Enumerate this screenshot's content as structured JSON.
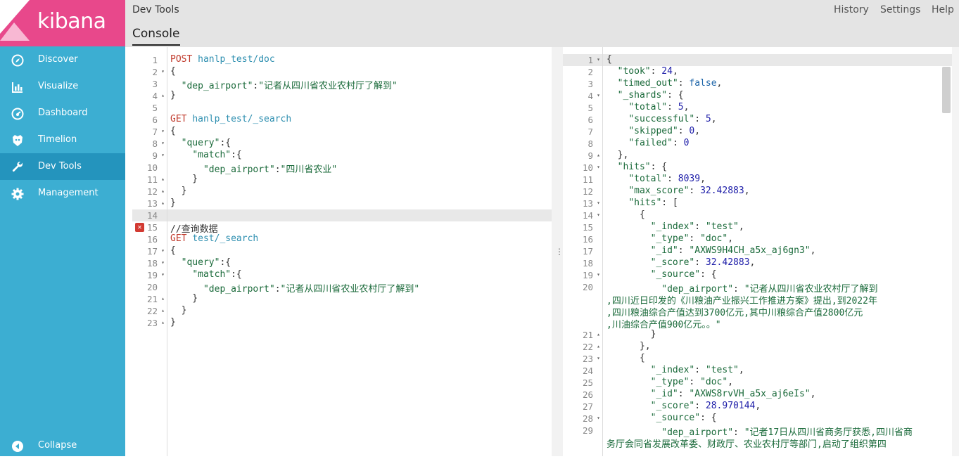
{
  "app": {
    "logo_text": "kibana"
  },
  "nav": [
    {
      "label": "Discover",
      "icon": "compass-icon"
    },
    {
      "label": "Visualize",
      "icon": "bar-chart-icon"
    },
    {
      "label": "Dashboard",
      "icon": "dashboard-icon"
    },
    {
      "label": "Timelion",
      "icon": "timelion-icon"
    },
    {
      "label": "Dev Tools",
      "icon": "wrench-icon",
      "active": true
    },
    {
      "label": "Management",
      "icon": "gear-icon"
    }
  ],
  "collapse_label": "Collapse",
  "header": {
    "breadcrumb": "Dev Tools",
    "links": [
      "History",
      "Settings",
      "Help"
    ],
    "tab": "Console"
  },
  "left_lines": [
    {
      "n": "1",
      "t": [
        [
          "k-m",
          "POST"
        ],
        [
          "k-p",
          " "
        ],
        [
          "k-u",
          "hanlp_test/doc"
        ]
      ]
    },
    {
      "n": "2",
      "f": "▾",
      "t": [
        [
          "k-p",
          "{"
        ]
      ]
    },
    {
      "n": "3",
      "t": [
        [
          "k-p",
          "  "
        ],
        [
          "k-s",
          "\"dep_airport\""
        ],
        [
          "k-p",
          ":"
        ],
        [
          "k-s",
          "\"记者从四川省农业农村厅了解到\""
        ]
      ]
    },
    {
      "n": "4",
      "f": "▴",
      "t": [
        [
          "k-p",
          "}"
        ]
      ]
    },
    {
      "n": "5",
      "t": []
    },
    {
      "n": "6",
      "t": [
        [
          "k-m",
          "GET"
        ],
        [
          "k-p",
          " "
        ],
        [
          "k-u",
          "hanlp_test/_search"
        ]
      ]
    },
    {
      "n": "7",
      "f": "▾",
      "t": [
        [
          "k-p",
          "{"
        ]
      ]
    },
    {
      "n": "8",
      "f": "▾",
      "t": [
        [
          "k-p",
          "  "
        ],
        [
          "k-s",
          "\"query\""
        ],
        [
          "k-p",
          ":{"
        ]
      ]
    },
    {
      "n": "9",
      "f": "▾",
      "t": [
        [
          "k-p",
          "    "
        ],
        [
          "k-s",
          "\"match\""
        ],
        [
          "k-p",
          ":{"
        ]
      ]
    },
    {
      "n": "10",
      "t": [
        [
          "k-p",
          "      "
        ],
        [
          "k-s",
          "\"dep_airport\""
        ],
        [
          "k-p",
          ":"
        ],
        [
          "k-s",
          "\"四川省农业\""
        ]
      ]
    },
    {
      "n": "11",
      "f": "▴",
      "t": [
        [
          "k-p",
          "    }"
        ]
      ]
    },
    {
      "n": "12",
      "f": "▴",
      "t": [
        [
          "k-p",
          "  }"
        ]
      ]
    },
    {
      "n": "13",
      "f": "▴",
      "t": [
        [
          "k-p",
          "}"
        ]
      ]
    },
    {
      "n": "14",
      "t": []
    },
    {
      "n": "15",
      "err": true,
      "t": [
        [
          "k-p",
          "//查询数据"
        ]
      ]
    },
    {
      "n": "16",
      "t": [
        [
          "k-m",
          "GET"
        ],
        [
          "k-p",
          " "
        ],
        [
          "k-u",
          "test/_search"
        ]
      ]
    },
    {
      "n": "17",
      "f": "▾",
      "t": [
        [
          "k-p",
          "{"
        ]
      ]
    },
    {
      "n": "18",
      "f": "▾",
      "t": [
        [
          "k-p",
          "  "
        ],
        [
          "k-s",
          "\"query\""
        ],
        [
          "k-p",
          ":{"
        ]
      ]
    },
    {
      "n": "19",
      "f": "▾",
      "t": [
        [
          "k-p",
          "    "
        ],
        [
          "k-s",
          "\"match\""
        ],
        [
          "k-p",
          ":{"
        ]
      ]
    },
    {
      "n": "20",
      "t": [
        [
          "k-p",
          "      "
        ],
        [
          "k-s",
          "\"dep_airport\""
        ],
        [
          "k-p",
          ":"
        ],
        [
          "k-s",
          "\"记者从四川省农业农村厅了解到\""
        ]
      ]
    },
    {
      "n": "21",
      "f": "▴",
      "t": [
        [
          "k-p",
          "    }"
        ]
      ]
    },
    {
      "n": "22",
      "f": "▴",
      "t": [
        [
          "k-p",
          "  }"
        ]
      ]
    },
    {
      "n": "23",
      "f": "▴",
      "t": [
        [
          "k-p",
          "}"
        ]
      ]
    }
  ],
  "right_lines": [
    {
      "n": "1",
      "f": "▾",
      "t": [
        [
          "k-p",
          "{"
        ]
      ]
    },
    {
      "n": "2",
      "t": [
        [
          "k-p",
          "  "
        ],
        [
          "k-s",
          "\"took\""
        ],
        [
          "k-p",
          ": "
        ],
        [
          "k-n",
          "24"
        ],
        [
          "k-p",
          ","
        ]
      ]
    },
    {
      "n": "3",
      "t": [
        [
          "k-p",
          "  "
        ],
        [
          "k-s",
          "\"timed_out\""
        ],
        [
          "k-p",
          ": "
        ],
        [
          "k-b",
          "false"
        ],
        [
          "k-p",
          ","
        ]
      ]
    },
    {
      "n": "4",
      "f": "▾",
      "t": [
        [
          "k-p",
          "  "
        ],
        [
          "k-s",
          "\"_shards\""
        ],
        [
          "k-p",
          ": {"
        ]
      ]
    },
    {
      "n": "5",
      "t": [
        [
          "k-p",
          "    "
        ],
        [
          "k-s",
          "\"total\""
        ],
        [
          "k-p",
          ": "
        ],
        [
          "k-n",
          "5"
        ],
        [
          "k-p",
          ","
        ]
      ]
    },
    {
      "n": "6",
      "t": [
        [
          "k-p",
          "    "
        ],
        [
          "k-s",
          "\"successful\""
        ],
        [
          "k-p",
          ": "
        ],
        [
          "k-n",
          "5"
        ],
        [
          "k-p",
          ","
        ]
      ]
    },
    {
      "n": "7",
      "t": [
        [
          "k-p",
          "    "
        ],
        [
          "k-s",
          "\"skipped\""
        ],
        [
          "k-p",
          ": "
        ],
        [
          "k-n",
          "0"
        ],
        [
          "k-p",
          ","
        ]
      ]
    },
    {
      "n": "8",
      "t": [
        [
          "k-p",
          "    "
        ],
        [
          "k-s",
          "\"failed\""
        ],
        [
          "k-p",
          ": "
        ],
        [
          "k-n",
          "0"
        ]
      ]
    },
    {
      "n": "9",
      "f": "▴",
      "t": [
        [
          "k-p",
          "  },"
        ]
      ]
    },
    {
      "n": "10",
      "f": "▾",
      "t": [
        [
          "k-p",
          "  "
        ],
        [
          "k-s",
          "\"hits\""
        ],
        [
          "k-p",
          ": {"
        ]
      ]
    },
    {
      "n": "11",
      "t": [
        [
          "k-p",
          "    "
        ],
        [
          "k-s",
          "\"total\""
        ],
        [
          "k-p",
          ": "
        ],
        [
          "k-n",
          "8039"
        ],
        [
          "k-p",
          ","
        ]
      ]
    },
    {
      "n": "12",
      "t": [
        [
          "k-p",
          "    "
        ],
        [
          "k-s",
          "\"max_score\""
        ],
        [
          "k-p",
          ": "
        ],
        [
          "k-n",
          "32.42883"
        ],
        [
          "k-p",
          ","
        ]
      ]
    },
    {
      "n": "13",
      "f": "▾",
      "t": [
        [
          "k-p",
          "    "
        ],
        [
          "k-s",
          "\"hits\""
        ],
        [
          "k-p",
          ": ["
        ]
      ]
    },
    {
      "n": "14",
      "f": "▾",
      "t": [
        [
          "k-p",
          "      {"
        ]
      ]
    },
    {
      "n": "15",
      "t": [
        [
          "k-p",
          "        "
        ],
        [
          "k-s",
          "\"_index\""
        ],
        [
          "k-p",
          ": "
        ],
        [
          "k-s",
          "\"test\""
        ],
        [
          "k-p",
          ","
        ]
      ]
    },
    {
      "n": "16",
      "t": [
        [
          "k-p",
          "        "
        ],
        [
          "k-s",
          "\"_type\""
        ],
        [
          "k-p",
          ": "
        ],
        [
          "k-s",
          "\"doc\""
        ],
        [
          "k-p",
          ","
        ]
      ]
    },
    {
      "n": "17",
      "t": [
        [
          "k-p",
          "        "
        ],
        [
          "k-s",
          "\"_id\""
        ],
        [
          "k-p",
          ": "
        ],
        [
          "k-s",
          "\"AXWS9H4CH_a5x_aj6gn3\""
        ],
        [
          "k-p",
          ","
        ]
      ]
    },
    {
      "n": "18",
      "t": [
        [
          "k-p",
          "        "
        ],
        [
          "k-s",
          "\"_score\""
        ],
        [
          "k-p",
          ": "
        ],
        [
          "k-n",
          "32.42883"
        ],
        [
          "k-p",
          ","
        ]
      ]
    },
    {
      "n": "19",
      "f": "▾",
      "t": [
        [
          "k-p",
          "        "
        ],
        [
          "k-s",
          "\"_source\""
        ],
        [
          "k-p",
          ": {"
        ]
      ]
    },
    {
      "n": "20",
      "t": [
        [
          "k-p",
          "          "
        ],
        [
          "k-s",
          "\"dep_airport\""
        ],
        [
          "k-p",
          ": "
        ],
        [
          "k-s",
          "\"记者从四川省农业农村厅了解到"
        ]
      ]
    },
    {
      "n": "",
      "t": [
        [
          "k-s",
          ",四川近日印发的《川粮油产业振兴工作推进方案》提出,到2022年"
        ]
      ]
    },
    {
      "n": "",
      "t": [
        [
          "k-s",
          ",四川粮油综合产值达到3700亿元,其中川粮综合产值2800亿元"
        ]
      ]
    },
    {
      "n": "",
      "t": [
        [
          "k-s",
          ",川油综合产值900亿元。。\""
        ]
      ]
    },
    {
      "n": "21",
      "f": "▴",
      "t": [
        [
          "k-p",
          "        }"
        ]
      ]
    },
    {
      "n": "22",
      "f": "▴",
      "t": [
        [
          "k-p",
          "      },"
        ]
      ]
    },
    {
      "n": "23",
      "f": "▾",
      "t": [
        [
          "k-p",
          "      {"
        ]
      ]
    },
    {
      "n": "24",
      "t": [
        [
          "k-p",
          "        "
        ],
        [
          "k-s",
          "\"_index\""
        ],
        [
          "k-p",
          ": "
        ],
        [
          "k-s",
          "\"test\""
        ],
        [
          "k-p",
          ","
        ]
      ]
    },
    {
      "n": "25",
      "t": [
        [
          "k-p",
          "        "
        ],
        [
          "k-s",
          "\"_type\""
        ],
        [
          "k-p",
          ": "
        ],
        [
          "k-s",
          "\"doc\""
        ],
        [
          "k-p",
          ","
        ]
      ]
    },
    {
      "n": "26",
      "t": [
        [
          "k-p",
          "        "
        ],
        [
          "k-s",
          "\"_id\""
        ],
        [
          "k-p",
          ": "
        ],
        [
          "k-s",
          "\"AXWS8rvVH_a5x_aj6eIs\""
        ],
        [
          "k-p",
          ","
        ]
      ]
    },
    {
      "n": "27",
      "t": [
        [
          "k-p",
          "        "
        ],
        [
          "k-s",
          "\"_score\""
        ],
        [
          "k-p",
          ": "
        ],
        [
          "k-n",
          "28.970144"
        ],
        [
          "k-p",
          ","
        ]
      ]
    },
    {
      "n": "28",
      "f": "▾",
      "t": [
        [
          "k-p",
          "        "
        ],
        [
          "k-s",
          "\"_source\""
        ],
        [
          "k-p",
          ": {"
        ]
      ]
    },
    {
      "n": "29",
      "t": [
        [
          "k-p",
          "          "
        ],
        [
          "k-s",
          "\"dep_airport\""
        ],
        [
          "k-p",
          ": "
        ],
        [
          "k-s",
          "\"记者17日从四川省商务厅获悉,四川省商"
        ]
      ]
    },
    {
      "n": "",
      "t": [
        [
          "k-s",
          "务厅会同省发展改革委、财政厅、农业农村厅等部门,启动了组织第四"
        ]
      ]
    }
  ]
}
